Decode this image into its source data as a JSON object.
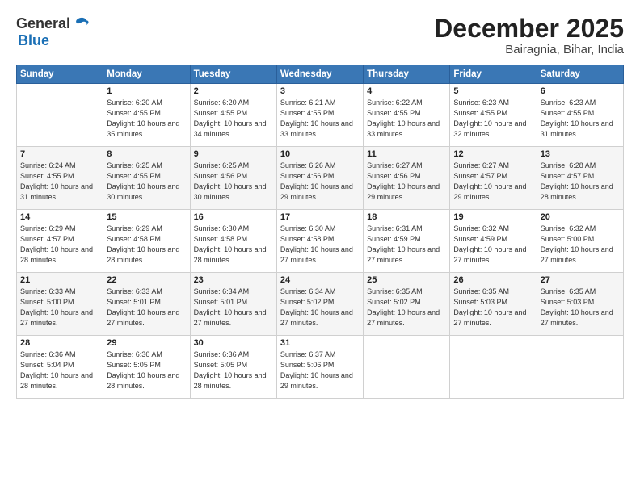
{
  "logo": {
    "general": "General",
    "blue": "Blue"
  },
  "header": {
    "month": "December 2025",
    "location": "Bairagnia, Bihar, India"
  },
  "weekdays": [
    "Sunday",
    "Monday",
    "Tuesday",
    "Wednesday",
    "Thursday",
    "Friday",
    "Saturday"
  ],
  "weeks": [
    [
      {
        "day": "",
        "sunrise": "",
        "sunset": "",
        "daylight": ""
      },
      {
        "day": "1",
        "sunrise": "Sunrise: 6:20 AM",
        "sunset": "Sunset: 4:55 PM",
        "daylight": "Daylight: 10 hours and 35 minutes."
      },
      {
        "day": "2",
        "sunrise": "Sunrise: 6:20 AM",
        "sunset": "Sunset: 4:55 PM",
        "daylight": "Daylight: 10 hours and 34 minutes."
      },
      {
        "day": "3",
        "sunrise": "Sunrise: 6:21 AM",
        "sunset": "Sunset: 4:55 PM",
        "daylight": "Daylight: 10 hours and 33 minutes."
      },
      {
        "day": "4",
        "sunrise": "Sunrise: 6:22 AM",
        "sunset": "Sunset: 4:55 PM",
        "daylight": "Daylight: 10 hours and 33 minutes."
      },
      {
        "day": "5",
        "sunrise": "Sunrise: 6:23 AM",
        "sunset": "Sunset: 4:55 PM",
        "daylight": "Daylight: 10 hours and 32 minutes."
      },
      {
        "day": "6",
        "sunrise": "Sunrise: 6:23 AM",
        "sunset": "Sunset: 4:55 PM",
        "daylight": "Daylight: 10 hours and 31 minutes."
      }
    ],
    [
      {
        "day": "7",
        "sunrise": "Sunrise: 6:24 AM",
        "sunset": "Sunset: 4:55 PM",
        "daylight": "Daylight: 10 hours and 31 minutes."
      },
      {
        "day": "8",
        "sunrise": "Sunrise: 6:25 AM",
        "sunset": "Sunset: 4:55 PM",
        "daylight": "Daylight: 10 hours and 30 minutes."
      },
      {
        "day": "9",
        "sunrise": "Sunrise: 6:25 AM",
        "sunset": "Sunset: 4:56 PM",
        "daylight": "Daylight: 10 hours and 30 minutes."
      },
      {
        "day": "10",
        "sunrise": "Sunrise: 6:26 AM",
        "sunset": "Sunset: 4:56 PM",
        "daylight": "Daylight: 10 hours and 29 minutes."
      },
      {
        "day": "11",
        "sunrise": "Sunrise: 6:27 AM",
        "sunset": "Sunset: 4:56 PM",
        "daylight": "Daylight: 10 hours and 29 minutes."
      },
      {
        "day": "12",
        "sunrise": "Sunrise: 6:27 AM",
        "sunset": "Sunset: 4:57 PM",
        "daylight": "Daylight: 10 hours and 29 minutes."
      },
      {
        "day": "13",
        "sunrise": "Sunrise: 6:28 AM",
        "sunset": "Sunset: 4:57 PM",
        "daylight": "Daylight: 10 hours and 28 minutes."
      }
    ],
    [
      {
        "day": "14",
        "sunrise": "Sunrise: 6:29 AM",
        "sunset": "Sunset: 4:57 PM",
        "daylight": "Daylight: 10 hours and 28 minutes."
      },
      {
        "day": "15",
        "sunrise": "Sunrise: 6:29 AM",
        "sunset": "Sunset: 4:58 PM",
        "daylight": "Daylight: 10 hours and 28 minutes."
      },
      {
        "day": "16",
        "sunrise": "Sunrise: 6:30 AM",
        "sunset": "Sunset: 4:58 PM",
        "daylight": "Daylight: 10 hours and 28 minutes."
      },
      {
        "day": "17",
        "sunrise": "Sunrise: 6:30 AM",
        "sunset": "Sunset: 4:58 PM",
        "daylight": "Daylight: 10 hours and 27 minutes."
      },
      {
        "day": "18",
        "sunrise": "Sunrise: 6:31 AM",
        "sunset": "Sunset: 4:59 PM",
        "daylight": "Daylight: 10 hours and 27 minutes."
      },
      {
        "day": "19",
        "sunrise": "Sunrise: 6:32 AM",
        "sunset": "Sunset: 4:59 PM",
        "daylight": "Daylight: 10 hours and 27 minutes."
      },
      {
        "day": "20",
        "sunrise": "Sunrise: 6:32 AM",
        "sunset": "Sunset: 5:00 PM",
        "daylight": "Daylight: 10 hours and 27 minutes."
      }
    ],
    [
      {
        "day": "21",
        "sunrise": "Sunrise: 6:33 AM",
        "sunset": "Sunset: 5:00 PM",
        "daylight": "Daylight: 10 hours and 27 minutes."
      },
      {
        "day": "22",
        "sunrise": "Sunrise: 6:33 AM",
        "sunset": "Sunset: 5:01 PM",
        "daylight": "Daylight: 10 hours and 27 minutes."
      },
      {
        "day": "23",
        "sunrise": "Sunrise: 6:34 AM",
        "sunset": "Sunset: 5:01 PM",
        "daylight": "Daylight: 10 hours and 27 minutes."
      },
      {
        "day": "24",
        "sunrise": "Sunrise: 6:34 AM",
        "sunset": "Sunset: 5:02 PM",
        "daylight": "Daylight: 10 hours and 27 minutes."
      },
      {
        "day": "25",
        "sunrise": "Sunrise: 6:35 AM",
        "sunset": "Sunset: 5:02 PM",
        "daylight": "Daylight: 10 hours and 27 minutes."
      },
      {
        "day": "26",
        "sunrise": "Sunrise: 6:35 AM",
        "sunset": "Sunset: 5:03 PM",
        "daylight": "Daylight: 10 hours and 27 minutes."
      },
      {
        "day": "27",
        "sunrise": "Sunrise: 6:35 AM",
        "sunset": "Sunset: 5:03 PM",
        "daylight": "Daylight: 10 hours and 27 minutes."
      }
    ],
    [
      {
        "day": "28",
        "sunrise": "Sunrise: 6:36 AM",
        "sunset": "Sunset: 5:04 PM",
        "daylight": "Daylight: 10 hours and 28 minutes."
      },
      {
        "day": "29",
        "sunrise": "Sunrise: 6:36 AM",
        "sunset": "Sunset: 5:05 PM",
        "daylight": "Daylight: 10 hours and 28 minutes."
      },
      {
        "day": "30",
        "sunrise": "Sunrise: 6:36 AM",
        "sunset": "Sunset: 5:05 PM",
        "daylight": "Daylight: 10 hours and 28 minutes."
      },
      {
        "day": "31",
        "sunrise": "Sunrise: 6:37 AM",
        "sunset": "Sunset: 5:06 PM",
        "daylight": "Daylight: 10 hours and 29 minutes."
      },
      {
        "day": "",
        "sunrise": "",
        "sunset": "",
        "daylight": ""
      },
      {
        "day": "",
        "sunrise": "",
        "sunset": "",
        "daylight": ""
      },
      {
        "day": "",
        "sunrise": "",
        "sunset": "",
        "daylight": ""
      }
    ]
  ]
}
